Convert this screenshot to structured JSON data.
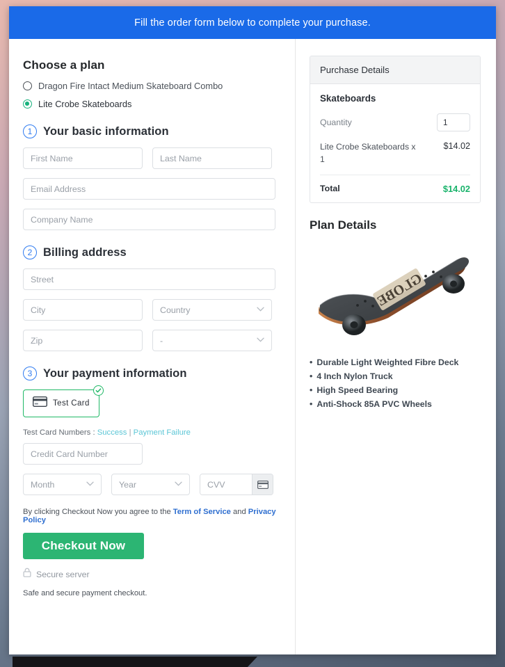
{
  "banner": {
    "text": "Fill the order form below to complete your purchase."
  },
  "plan_chooser": {
    "heading": "Choose a plan",
    "options": [
      {
        "label": "Dragon Fire Intact Medium Skateboard Combo",
        "selected": false
      },
      {
        "label": "Lite Crobe Skateboards",
        "selected": true
      }
    ]
  },
  "steps": {
    "basic": {
      "number": "1",
      "title": "Your basic information",
      "fields": {
        "first_name": {
          "placeholder": "First Name",
          "value": ""
        },
        "last_name": {
          "placeholder": "Last Name",
          "value": ""
        },
        "email": {
          "placeholder": "Email Address",
          "value": ""
        },
        "company": {
          "placeholder": "Company Name",
          "value": ""
        }
      }
    },
    "billing": {
      "number": "2",
      "title": "Billing address",
      "fields": {
        "street": {
          "placeholder": "Street",
          "value": ""
        },
        "city": {
          "placeholder": "City",
          "value": ""
        },
        "country": {
          "placeholder": "Country",
          "value": "Country"
        },
        "zip": {
          "placeholder": "Zip",
          "value": ""
        },
        "state": {
          "placeholder": "-",
          "value": "-"
        }
      }
    },
    "payment": {
      "number": "3",
      "title": "Your payment information",
      "method": {
        "label": "Test Card",
        "selected": true,
        "icon": "credit-card-icon",
        "badge_icon": "check-circle-icon"
      },
      "test_cards": {
        "prefix": "Test Card Numbers : ",
        "success_link": "Success",
        "separator": " | ",
        "failure_link": "Payment Failure"
      },
      "fields": {
        "card_number": {
          "placeholder": "Credit Card Number",
          "value": ""
        },
        "month": {
          "placeholder": "Month",
          "value": "Month"
        },
        "year": {
          "placeholder": "Year",
          "value": "Year"
        },
        "cvv": {
          "placeholder": "CVV",
          "value": ""
        }
      },
      "cvv_icon": "credit-card-icon"
    }
  },
  "footer": {
    "terms_prefix": "By clicking Checkout Now you agree to the ",
    "terms_link": "Term of Service",
    "terms_middle": " and ",
    "privacy_link": "Privacy Policy",
    "checkout_label": "Checkout Now",
    "secure_icon": "lock-icon",
    "secure_text": "Secure server",
    "safe_note": "Safe and secure payment checkout."
  },
  "purchase_details": {
    "header": "Purchase Details",
    "product_group": "Skateboards",
    "quantity_label": "Quantity",
    "quantity_value": "1",
    "line_item": {
      "description": "Lite Crobe Skateboards x 1",
      "amount": "$14.02"
    },
    "total_label": "Total",
    "total_amount": "$14.02"
  },
  "plan_details": {
    "title": "Plan Details",
    "image_alt": "globe-skateboard-image",
    "deck_logo_text": "GLOBE",
    "features": [
      "Durable Light Weighted Fibre Deck",
      "4 Inch Nylon Truck",
      "High Speed Bearing",
      "Anti-Shock 85A PVC Wheels"
    ]
  },
  "colors": {
    "banner_blue": "#1a6ae8",
    "accent_green": "#2cb573",
    "radio_green": "#18b27d",
    "total_green": "#19b36b",
    "step_blue": "#2f7bf0",
    "link_blue": "#2f6fd0",
    "testcard_link": "#5bc6d6"
  }
}
